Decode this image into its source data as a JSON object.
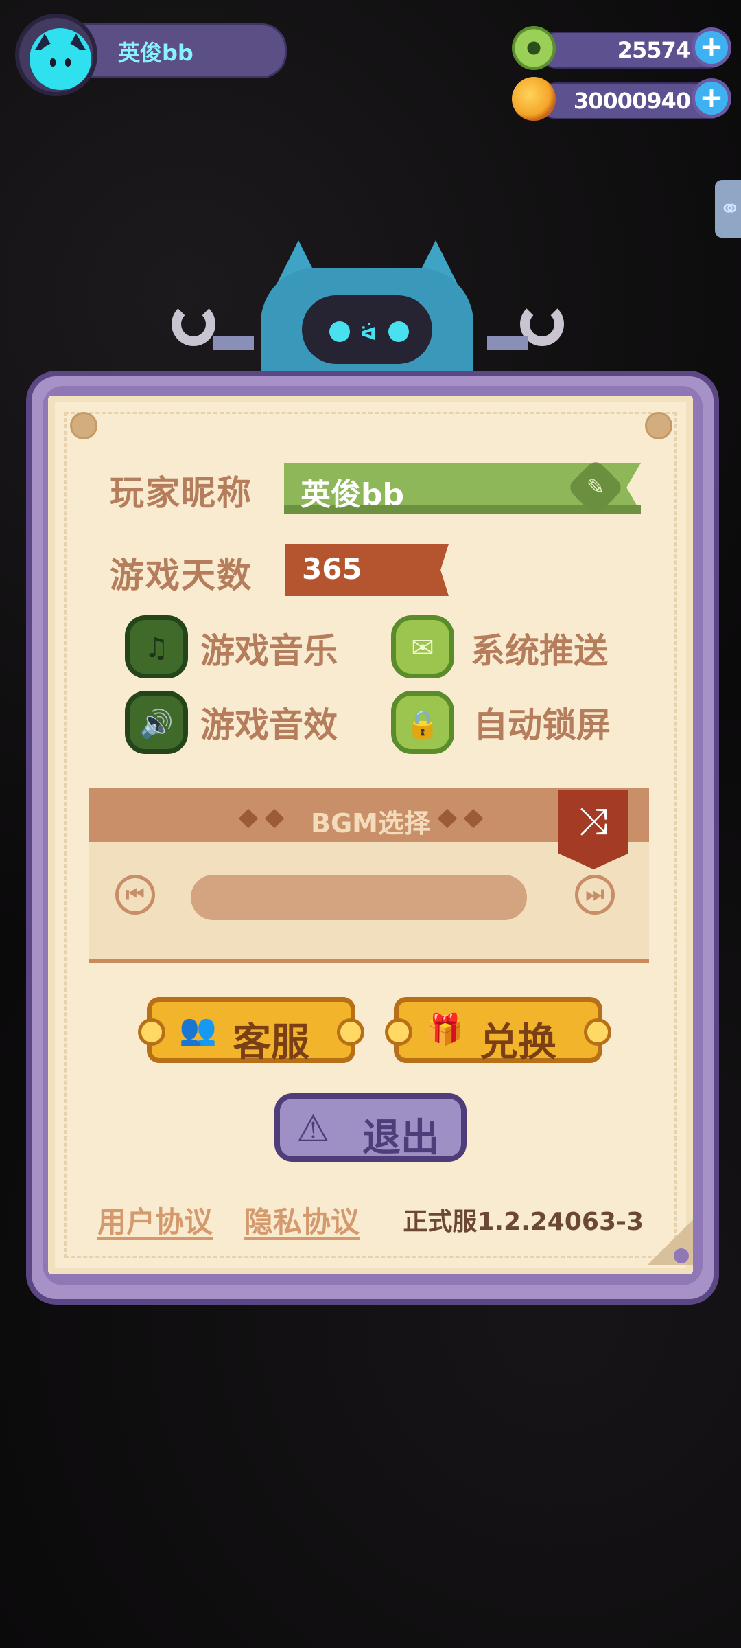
{
  "player": {
    "name": "英俊bb"
  },
  "currency": {
    "coins": "25574",
    "gems": "30000940"
  },
  "settings": {
    "nickname_label": "玩家昵称",
    "nickname_value": "英俊bb",
    "days_label": "游戏天数",
    "days_value": "365",
    "options": [
      {
        "label": "游戏音乐",
        "icon": "music-icon"
      },
      {
        "label": "系统推送",
        "icon": "mail-icon"
      },
      {
        "label": "游戏音效",
        "icon": "speaker-icon"
      },
      {
        "label": "自动锁屏",
        "icon": "lock-icon"
      }
    ],
    "bgm_title": "BGM选择",
    "buttons": {
      "service": "客服",
      "redeem": "兑换",
      "quit": "退出"
    },
    "links": {
      "user_agreement": "用户协议",
      "privacy": "隐私协议"
    },
    "version": "正式服1.2.24063-3"
  },
  "colors": {
    "panel_purple": "#a792c8",
    "paper": "#f8ebd0",
    "accent_green": "#8eb75a",
    "accent_orange": "#b5552f",
    "button_yellow": "#f2b42b"
  }
}
